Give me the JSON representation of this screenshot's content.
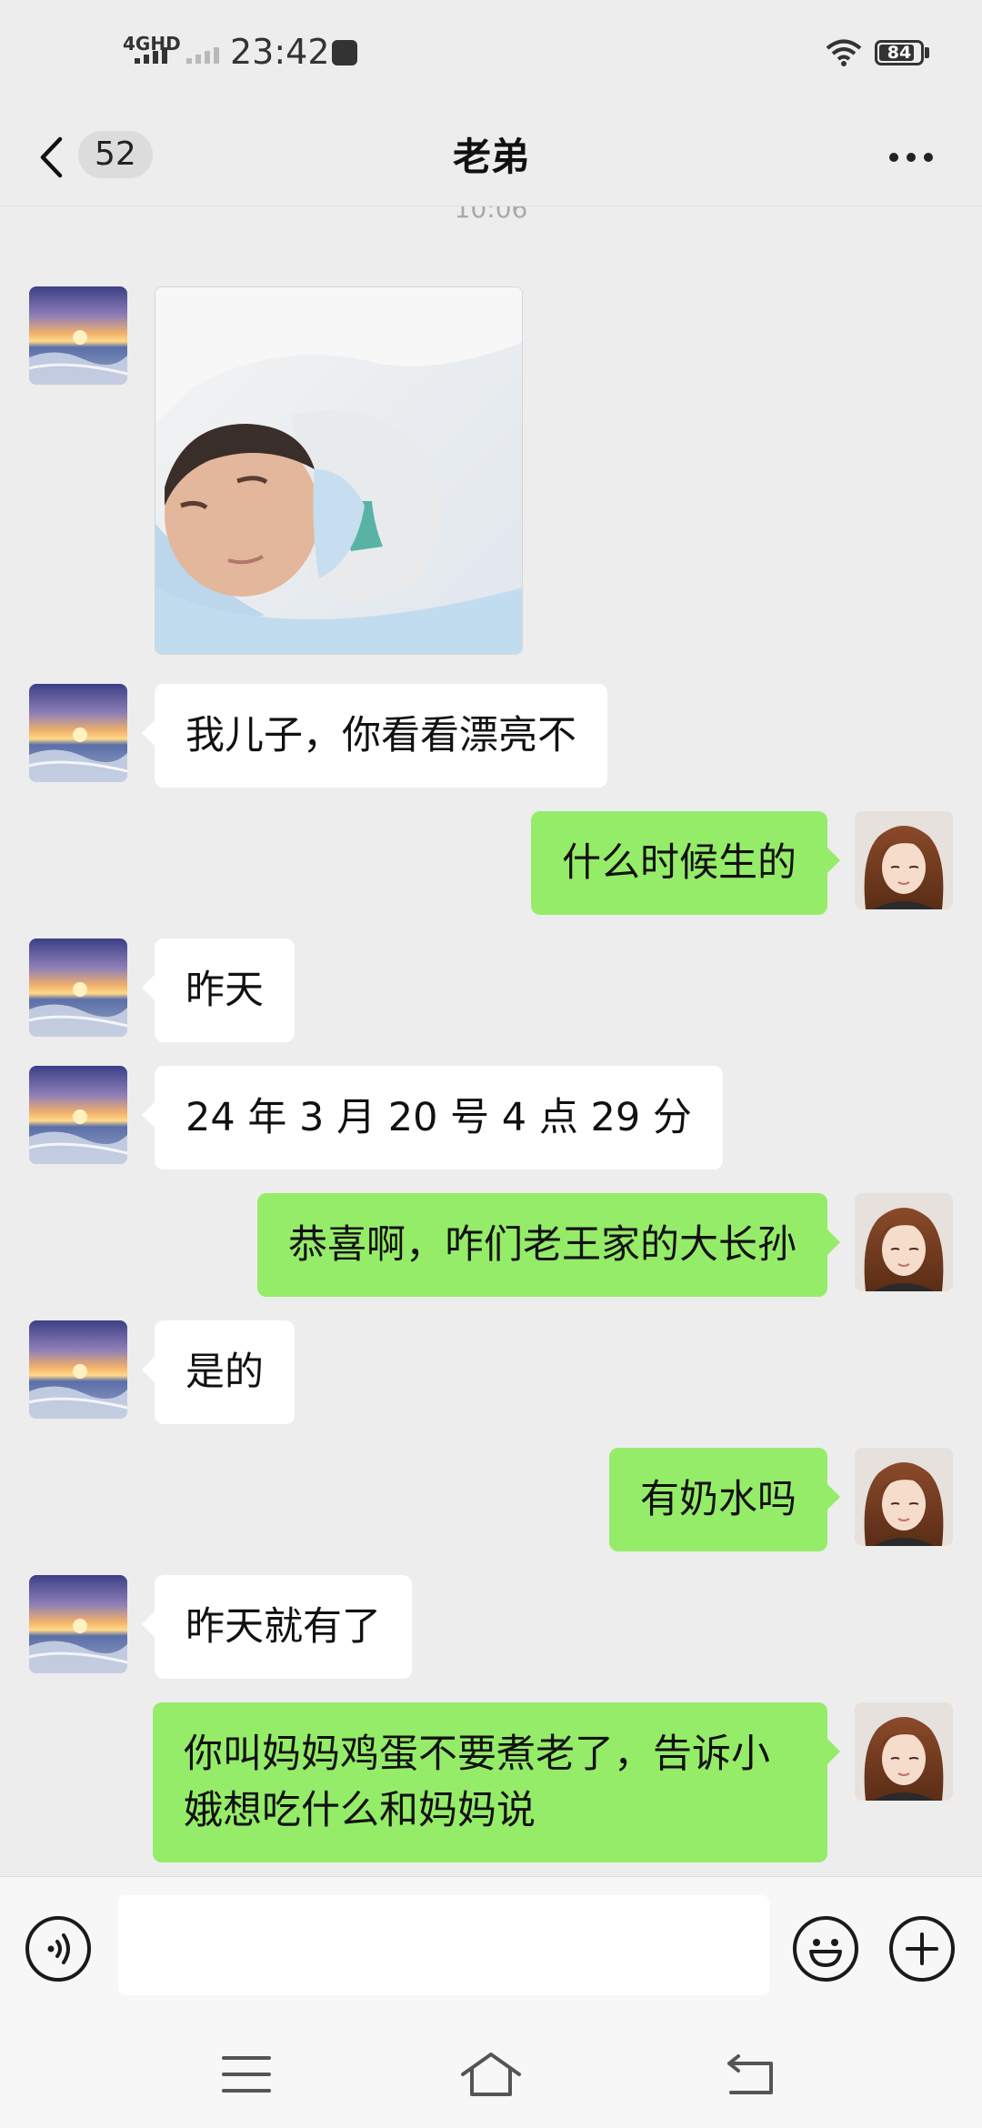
{
  "status_bar": {
    "network": "4GHD",
    "time": "23:42",
    "battery": "84"
  },
  "nav": {
    "unread_count": "52",
    "title": "老弟"
  },
  "chat": {
    "timestamp": "10:06",
    "messages": [
      {
        "side": "left",
        "type": "image",
        "image": "newborn-baby-photo"
      },
      {
        "side": "left",
        "type": "text",
        "text": "我儿子，你看看漂亮不"
      },
      {
        "side": "right",
        "type": "text",
        "text": "什么时候生的"
      },
      {
        "side": "left",
        "type": "text",
        "text": "昨天"
      },
      {
        "side": "left",
        "type": "text",
        "text": "24 年 3 月 20 号 4 点 29 分"
      },
      {
        "side": "right",
        "type": "text",
        "text": "恭喜啊，咋们老王家的大长孙"
      },
      {
        "side": "left",
        "type": "text",
        "text": "是的"
      },
      {
        "side": "right",
        "type": "text",
        "text": "有奶水吗"
      },
      {
        "side": "left",
        "type": "text",
        "text": "昨天就有了"
      },
      {
        "side": "right",
        "type": "text",
        "text": "你叫妈妈鸡蛋不要煮老了，告诉小娥想吃什么和妈妈说"
      }
    ]
  },
  "input": {
    "value": "",
    "placeholder": ""
  },
  "icons": {
    "back": "back-arrow-icon",
    "more": "more-dots-icon",
    "voice": "voice-icon",
    "emoji": "emoji-icon",
    "plus": "plus-icon",
    "menu": "menu-icon",
    "home": "home-icon",
    "return": "return-icon"
  },
  "colors": {
    "background": "#ededed",
    "sent_bubble": "#95ec69",
    "received_bubble": "#ffffff"
  }
}
